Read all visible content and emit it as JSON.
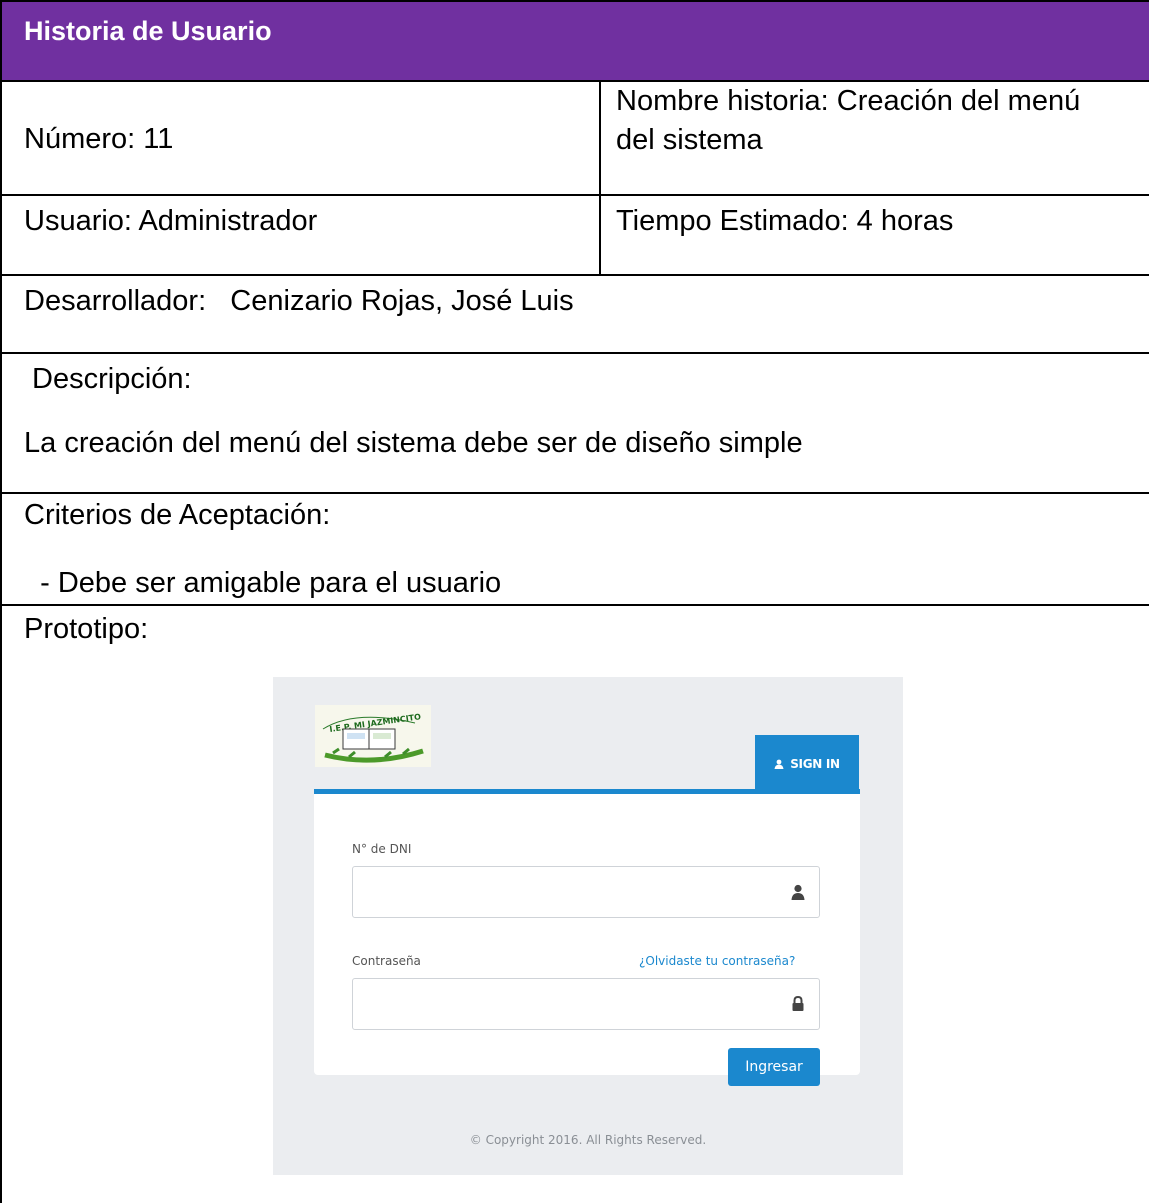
{
  "header": {
    "title": "Historia de Usuario"
  },
  "fields": {
    "numero": "Número: 11",
    "nombre_historia_line1": "Nombre historia: Creación del menú",
    "nombre_historia_line2": "del sistema",
    "usuario": "Usuario: Administrador",
    "tiempo": "Tiempo Estimado: 4 horas",
    "desarrollador": "Desarrollador:   Cenizario Rojas, José Luis",
    "descripcion_label": " Descripción:",
    "descripcion_text": "La creación del menú del sistema debe ser de diseño simple",
    "criterios_label": "Criterios de Aceptación:",
    "criterios_item": "  - Debe ser amigable para el usuario",
    "prototipo_label": "Prototipo:"
  },
  "prototype": {
    "logo_text": "I.E.P. MI JAZMINCITO",
    "signin_tab": "SIGN IN",
    "dni_label": "N° de DNI",
    "password_label": "Contraseña",
    "forgot_link": "¿Olvidaste tu contraseña?",
    "submit_button": "Ingresar",
    "copyright": "© Copyright 2016. All Rights Reserved.",
    "accent_color": "#1b88ce",
    "icons": [
      "user-icon",
      "lock-icon"
    ]
  },
  "colors": {
    "header_bg": "#7030a0"
  }
}
